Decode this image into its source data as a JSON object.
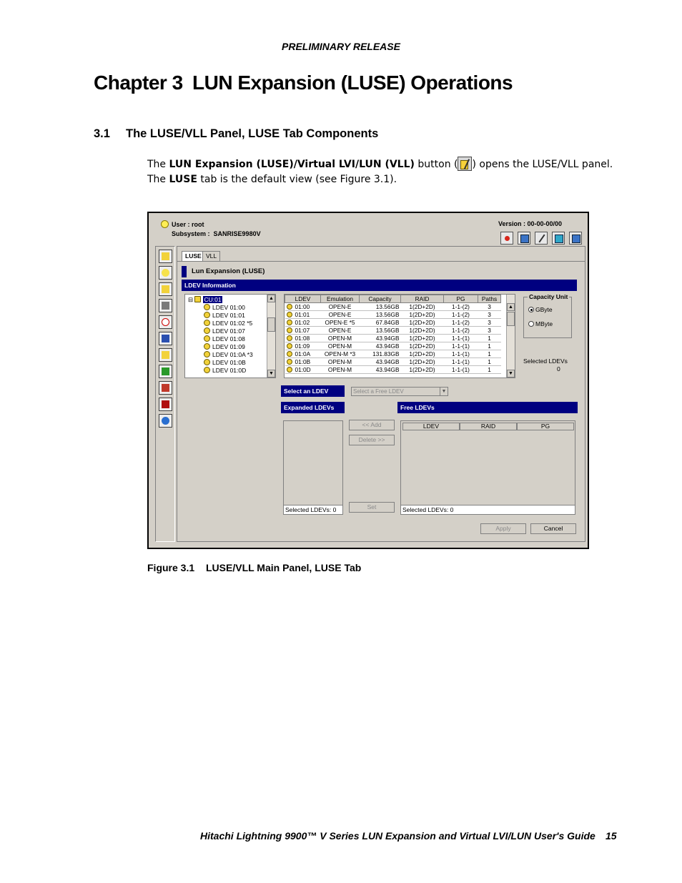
{
  "header": "PRELIMINARY RELEASE",
  "chapter": {
    "number": "Chapter 3",
    "title": "LUN Expansion (LUSE) Operations"
  },
  "section": {
    "number": "3.1",
    "title": "The LUSE/VLL Panel, LUSE Tab Components"
  },
  "body": {
    "line1_a": "The ",
    "line1_b": "LUN Expansion (LUSE)/Virtual LVI/LUN (VLL)",
    "line1_c": " button (",
    "line1_d": ") opens the LUSE/VLL panel.",
    "line2_a": "The ",
    "line2_b": "LUSE",
    "line2_c": " tab is the default view (see Figure 3.1)."
  },
  "screenshot": {
    "user": "User : root",
    "subsystem_label": "Subsystem :",
    "subsystem_value": "SANRISE9980V",
    "version": "Version : 00-00-00/00",
    "tabs": [
      "LUSE",
      "VLL"
    ],
    "panel_title": "Lun Expansion (LUSE)",
    "ldev_info_label": "LDEV Information",
    "tree": {
      "root": "CU:01",
      "items": [
        "LDEV 01:00",
        "LDEV 01:01",
        "LDEV 01:02 *5",
        "LDEV 01:07",
        "LDEV 01:08",
        "LDEV 01:09",
        "LDEV 01:0A *3",
        "LDEV 01:0B",
        "LDEV 01:0D"
      ]
    },
    "table": {
      "columns": [
        "LDEV",
        "Emulation",
        "Capacity",
        "RAID",
        "PG",
        "Paths"
      ],
      "rows": [
        [
          "01:00",
          "OPEN-E",
          "13.56GB",
          "1(2D+2D)",
          "1-1-(2)",
          "3"
        ],
        [
          "01:01",
          "OPEN-E",
          "13.56GB",
          "1(2D+2D)",
          "1-1-(2)",
          "3"
        ],
        [
          "01:02",
          "OPEN-E *5",
          "67.84GB",
          "1(2D+2D)",
          "1-1-(2)",
          "3"
        ],
        [
          "01:07",
          "OPEN-E",
          "13.56GB",
          "1(2D+2D)",
          "1-1-(2)",
          "3"
        ],
        [
          "01:08",
          "OPEN-M",
          "43.94GB",
          "1(2D+2D)",
          "1-1-(1)",
          "1"
        ],
        [
          "01:09",
          "OPEN-M",
          "43.94GB",
          "1(2D+2D)",
          "1-1-(1)",
          "1"
        ],
        [
          "01:0A",
          "OPEN-M *3",
          "131.83GB",
          "1(2D+2D)",
          "1-1-(1)",
          "1"
        ],
        [
          "01:0B",
          "OPEN-M",
          "43.94GB",
          "1(2D+2D)",
          "1-1-(1)",
          "1"
        ],
        [
          "01:0D",
          "OPEN-M",
          "43.94GB",
          "1(2D+2D)",
          "1-1-(1)",
          "1"
        ]
      ]
    },
    "capacity_unit": {
      "label": "Capacity Unit",
      "options": [
        "GByte",
        "MByte"
      ],
      "selected": "GByte"
    },
    "selected_ldevs_label": "Selected LDEVs",
    "selected_ldevs_value": "0",
    "select_an_ldev": "Select an LDEV",
    "select_placeholder": "Select a Free LDEV",
    "expanded_ldevs": "Expanded LDEVs",
    "free_ldevs": "Free LDEVs",
    "free_columns": [
      "LDEV",
      "RAID",
      "PG"
    ],
    "buttons": {
      "add": "<< Add",
      "delete": "Delete >>",
      "set": "Set",
      "apply": "Apply",
      "cancel": "Cancel"
    },
    "expanded_status": "Selected LDEVs:  0",
    "free_status": "Selected LDEVs:  0"
  },
  "caption": {
    "number": "Figure 3.1",
    "title": "LUSE/VLL Main Panel, LUSE Tab"
  },
  "footer": "Hitachi Lightning 9900™ V Series LUN Expansion and Virtual LVI/LUN User's Guide",
  "page_number": "15",
  "colors": {
    "title_bar": "#000080",
    "panel_bg": "#d4d0c8"
  }
}
